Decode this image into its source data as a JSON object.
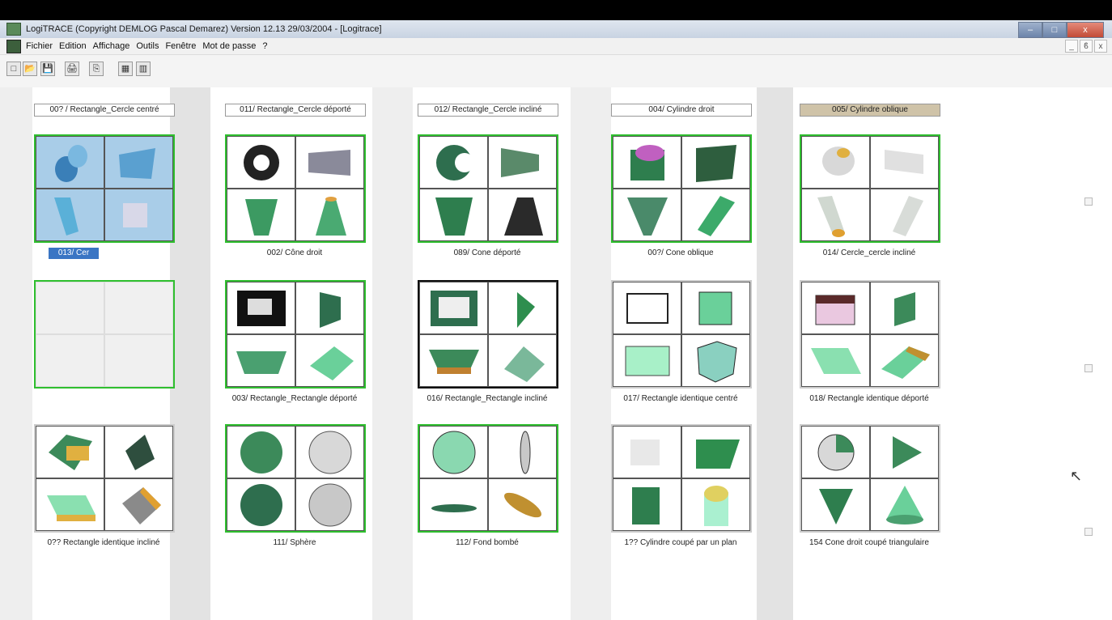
{
  "window": {
    "title": "LogiTRACE (Copyright DEMLOG Pascal Demarez) Version 12.13 29/03/2004 - [Logitrace]",
    "buttons": [
      "–",
      "□",
      "x"
    ]
  },
  "menu": {
    "items": [
      "Fichier",
      "Edition",
      "Affichage",
      "Outils",
      "Fenêtre",
      "Mot de passe",
      "?"
    ],
    "mdi_buttons": [
      "_",
      "ϐ",
      "x"
    ]
  },
  "toolbar": {
    "buttons": [
      "□",
      "📂",
      "💾",
      "🖨",
      "⎘",
      "▦",
      "▥"
    ]
  },
  "columns": [
    {
      "header": "00? / Rectangle_Cercle centré"
    },
    {
      "header": "011/ Rectangle_Cercle déporté"
    },
    {
      "header": "012/ Rectangle_Cercle incliné"
    },
    {
      "header": "004/ Cylindre droit"
    },
    {
      "header": "005/ Cylindre oblique"
    }
  ],
  "row1_labels": [
    "013/ Cer",
    "002/ Cône droit",
    "089/ Cone déporté",
    "00?/ Cone oblique",
    "014/ Cercle_cercle incliné"
  ],
  "row2_labels": [
    "",
    "003/ Rectangle_Rectangle déporté",
    "016/ Rectangle_Rectangle incliné",
    "017/ Rectangle identique centré",
    "018/ Rectangle identique déporté"
  ],
  "row3_labels": [
    "0?? Rectangle identique incliné",
    "111/ Sphère",
    "112/ Fond bombé",
    "1?? Cylindre coupé par un plan",
    "154 Cone droit coupé triangulaire"
  ],
  "colors": {
    "tile_border_green": "#2fbf2f",
    "shape_green": "#3c9a62",
    "selection_blue": "#3a75c4"
  }
}
